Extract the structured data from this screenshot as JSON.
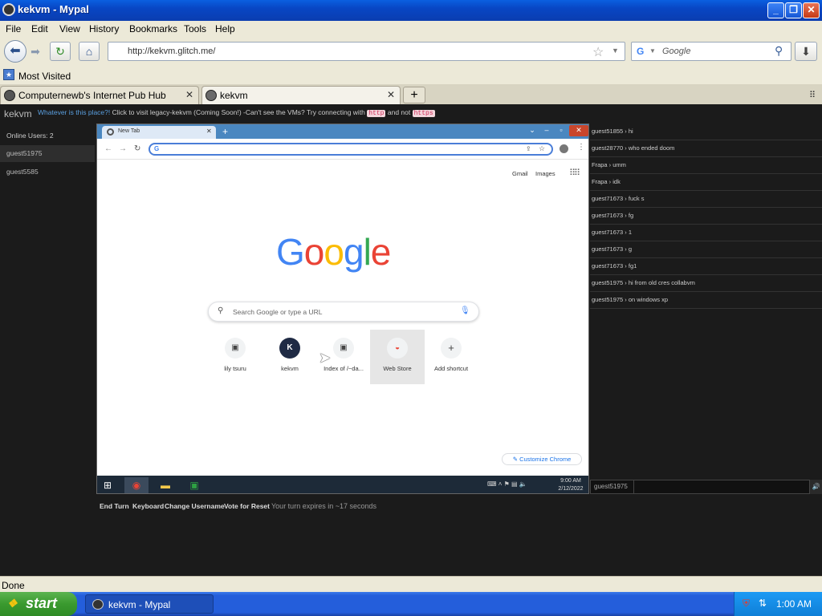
{
  "window": {
    "title": "kekvm - Mypal"
  },
  "menubar": [
    "File",
    "Edit",
    "View",
    "History",
    "Bookmarks",
    "Tools",
    "Help"
  ],
  "nav": {
    "url": "http://kekvm.glitch.me/",
    "search_placeholder": "Google",
    "search_engine_icon": "google-g-icon"
  },
  "bookmarks": {
    "label": "Most Visited"
  },
  "tabs": [
    {
      "label": "Computernewb's Internet Pub Hub",
      "active": false
    },
    {
      "label": "kekvm",
      "active": true
    }
  ],
  "page": {
    "logo": "kekvm",
    "intro": {
      "question": "Whatever is this place?!",
      "text1": "Click to visit legacy-kekvm (Coming Soon!) -Can't see the VMs? Try connecting with",
      "code_http": "http",
      "text2": "and not",
      "code_https": "https"
    },
    "online_users": "Online Users: 2",
    "users": [
      {
        "name": "guest51975",
        "selected": true
      },
      {
        "name": "guest5585",
        "selected": false
      }
    ],
    "turn": {
      "buttons": [
        "End Turn",
        "Keyboard",
        "Change Username",
        "Vote for Reset"
      ],
      "status": "Your turn expires in ~17 seconds"
    },
    "chat": [
      "guest51855 › hi",
      "guest28770 › who ended doom",
      "Frapa › umm",
      "Frapa › idk",
      "guest71673 › fuck s",
      "guest71673 › fg",
      "guest71673 › 1",
      "guest71673 › g",
      "guest71673 › fg1",
      "guest51975 › hi from old cres collabvm",
      "guest51975 › on windows xp"
    ],
    "chat_username": "guest51975"
  },
  "vm": {
    "chrome": {
      "tab_label": "New Tab",
      "omnibox_value": "",
      "links": {
        "gmail": "Gmail",
        "images": "Images"
      },
      "logo_letters": [
        "G",
        "o",
        "o",
        "g",
        "l",
        "e"
      ],
      "search_placeholder": "Search Google or type a URL",
      "shortcuts": [
        {
          "label": "lily tsuru",
          "glyph": "▣"
        },
        {
          "label": "kekvm",
          "glyph": "K"
        },
        {
          "label": "Index of /~da...",
          "glyph": "▣"
        },
        {
          "label": "Web Store",
          "glyph": "◒"
        },
        {
          "label": "Add shortcut",
          "glyph": "+"
        }
      ],
      "customize": "Customize Chrome"
    },
    "taskbar": {
      "time": "9:00 AM",
      "date": "2/12/2022"
    }
  },
  "statusbar": {
    "text": "Done"
  },
  "xp_taskbar": {
    "start": "start",
    "task": "kekvm - Mypal",
    "clock": "1:00 AM"
  },
  "colors": {
    "xp_blue": "#0a4fd4",
    "page_bg": "#1b1b1b",
    "link_blue": "#5a9fdf"
  }
}
